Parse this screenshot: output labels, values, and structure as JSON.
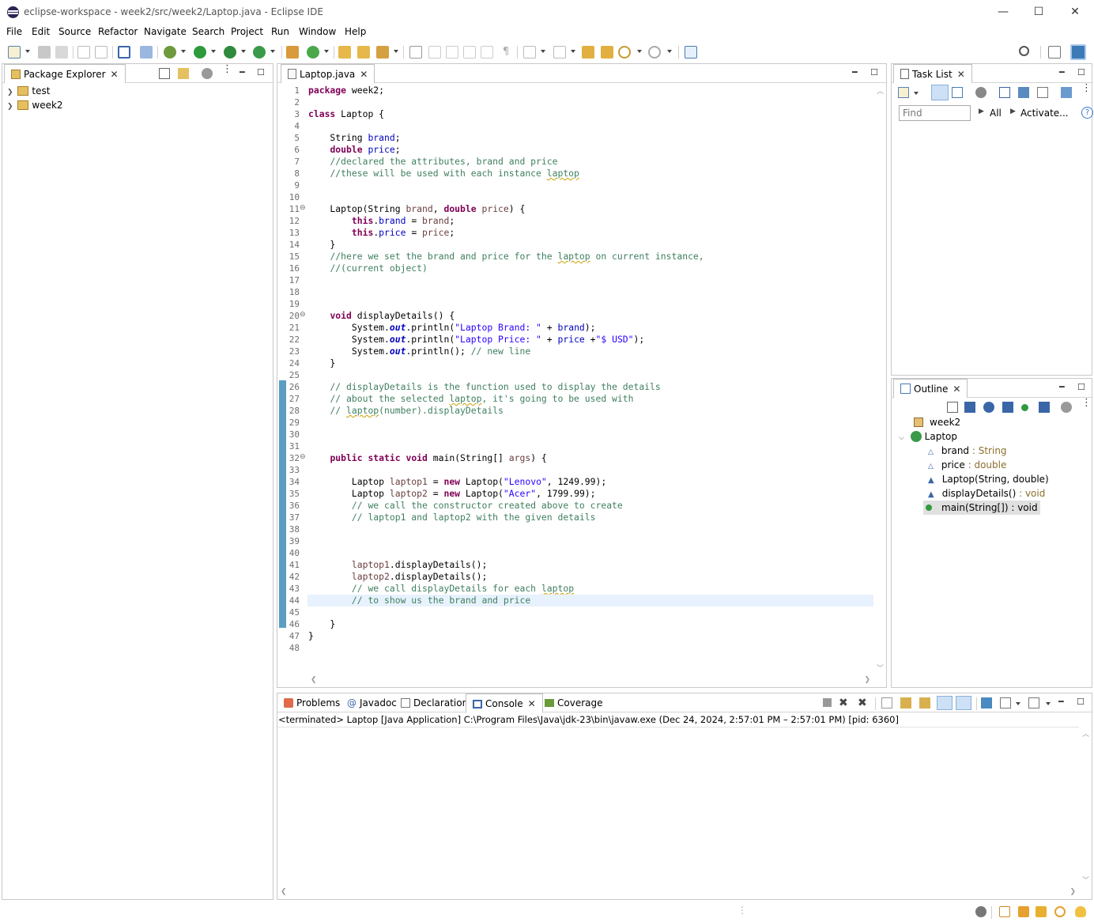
{
  "window": {
    "title": "eclipse-workspace - week2/src/week2/Laptop.java - Eclipse IDE",
    "minimize": "—",
    "maximize": "☐",
    "close": "✕"
  },
  "menu": [
    "File",
    "Edit",
    "Source",
    "Refactor",
    "Navigate",
    "Search",
    "Project",
    "Run",
    "Window",
    "Help"
  ],
  "package_explorer": {
    "tab_label": "Package Explorer",
    "projects": [
      "test",
      "week2"
    ]
  },
  "editor": {
    "tab_label": "Laptop.java",
    "lines": [
      {
        "n": "1",
        "html": "<span class=\"kw\">package</span> week2;"
      },
      {
        "n": "2",
        "html": ""
      },
      {
        "n": "3",
        "html": "<span class=\"kw\">class</span> Laptop {"
      },
      {
        "n": "4",
        "html": ""
      },
      {
        "n": "5",
        "html": "    String <span class=\"fld\">brand</span>;"
      },
      {
        "n": "6",
        "html": "    <span class=\"kw\">double</span> <span class=\"fld\">price</span>;"
      },
      {
        "n": "7",
        "html": "    <span class=\"cm\">//declared the attributes, brand and price</span>"
      },
      {
        "n": "8",
        "html": "    <span class=\"cm\">//these will be used with each instance <span class=\"squig\">laptop</span></span>"
      },
      {
        "n": "9",
        "html": ""
      },
      {
        "n": "10",
        "html": ""
      },
      {
        "n": "11",
        "html": "    Laptop(String <span class=\"vr\">brand</span>, <span class=\"kw\">double</span> <span class=\"vr\">price</span>) {",
        "fold": true
      },
      {
        "n": "12",
        "html": "        <span class=\"kw\">this</span>.<span class=\"fld\">brand</span> = <span class=\"vr\">brand</span>;"
      },
      {
        "n": "13",
        "html": "        <span class=\"kw\">this</span>.<span class=\"fld\">price</span> = <span class=\"vr\">price</span>;"
      },
      {
        "n": "14",
        "html": "    }"
      },
      {
        "n": "15",
        "html": "    <span class=\"cm\">//here we set the brand and price for the <span class=\"squig\">laptop</span> on current instance,</span>"
      },
      {
        "n": "16",
        "html": "    <span class=\"cm\">//(current object)</span>"
      },
      {
        "n": "17",
        "html": ""
      },
      {
        "n": "18",
        "html": ""
      },
      {
        "n": "19",
        "html": ""
      },
      {
        "n": "20",
        "html": "    <span class=\"kw\">void</span> displayDetails() {",
        "fold": true
      },
      {
        "n": "21",
        "html": "        System.<span class=\"sfld\">out</span>.println(<span class=\"str\">\"Laptop Brand: \"</span> + <span class=\"fld\">brand</span>);"
      },
      {
        "n": "22",
        "html": "        System.<span class=\"sfld\">out</span>.println(<span class=\"str\">\"Laptop Price: \"</span> + <span class=\"fld\">price</span> +<span class=\"str\">\"$ USD\"</span>);"
      },
      {
        "n": "23",
        "html": "        System.<span class=\"sfld\">out</span>.println(); <span class=\"cm\">// new line</span>"
      },
      {
        "n": "24",
        "html": "    }"
      },
      {
        "n": "25",
        "html": ""
      },
      {
        "n": "26",
        "html": "    <span class=\"cm\">// displayDetails is the function used to display the details</span>"
      },
      {
        "n": "27",
        "html": "    <span class=\"cm\">// about the selected <span class=\"squig\">laptop</span>, it's going to be used with</span>"
      },
      {
        "n": "28",
        "html": "    <span class=\"cm\">// <span class=\"squig\">laptop</span>(number).displayDetails</span>"
      },
      {
        "n": "29",
        "html": ""
      },
      {
        "n": "30",
        "html": ""
      },
      {
        "n": "31",
        "html": ""
      },
      {
        "n": "32",
        "html": "    <span class=\"kw\">public</span> <span class=\"kw\">static</span> <span class=\"kw\">void</span> main(String[] <span class=\"vr\">args</span>) {",
        "fold": true
      },
      {
        "n": "33",
        "html": ""
      },
      {
        "n": "34",
        "html": "        Laptop <span class=\"vr\">laptop1</span> = <span class=\"kw\">new</span> Laptop(<span class=\"str\">\"Lenovo\"</span>, 1249.99);"
      },
      {
        "n": "35",
        "html": "        Laptop <span class=\"vr\">laptop2</span> = <span class=\"kw\">new</span> Laptop(<span class=\"str\">\"Acer\"</span>, 1799.99);"
      },
      {
        "n": "36",
        "html": "        <span class=\"cm\">// we call the constructor created above to create</span>"
      },
      {
        "n": "37",
        "html": "        <span class=\"cm\">// laptop1 and laptop2 with the given details</span>"
      },
      {
        "n": "38",
        "html": ""
      },
      {
        "n": "39",
        "html": ""
      },
      {
        "n": "40",
        "html": ""
      },
      {
        "n": "41",
        "html": "        <span class=\"vr\">laptop1</span>.displayDetails();"
      },
      {
        "n": "42",
        "html": "        <span class=\"vr\">laptop2</span>.displayDetails();"
      },
      {
        "n": "43",
        "html": "        <span class=\"cm\">// we call displayDetails for each <span class=\"squig\">laptop</span></span>"
      },
      {
        "n": "44",
        "html": "        <span class=\"cm\">// to show us the brand and price</span>",
        "current": true
      },
      {
        "n": "45",
        "html": ""
      },
      {
        "n": "46",
        "html": "    }"
      },
      {
        "n": "47",
        "html": "}"
      },
      {
        "n": "48",
        "html": ""
      }
    ]
  },
  "task_list": {
    "tab_label": "Task List",
    "find_placeholder": "Find",
    "all_label": "All",
    "activate_label": "Activate..."
  },
  "outline": {
    "tab_label": "Outline",
    "items": [
      {
        "label": "week2",
        "type": ""
      },
      {
        "label": "Laptop",
        "type": ""
      },
      {
        "label": "brand",
        "type": " : String"
      },
      {
        "label": "price",
        "type": " : double"
      },
      {
        "label": "Laptop(String, double)",
        "type": ""
      },
      {
        "label": "displayDetails()",
        "type": " : void"
      },
      {
        "label": "main(String[]) : void",
        "type": ""
      }
    ]
  },
  "bottom": {
    "tabs": [
      "Problems",
      "Javadoc",
      "Declaration",
      "Console",
      "Coverage"
    ],
    "console_status": "<terminated> Laptop [Java Application] C:\\Program Files\\Java\\jdk-23\\bin\\javaw.exe  (Dec 24, 2024, 2:57:01 PM – 2:57:01 PM) [pid: 6360]"
  },
  "colors": {
    "keyword": "#7f0055",
    "string": "#2a00ff",
    "comment": "#3f7f5f",
    "field": "#0000c0",
    "current_line": "#e8f2fe"
  }
}
